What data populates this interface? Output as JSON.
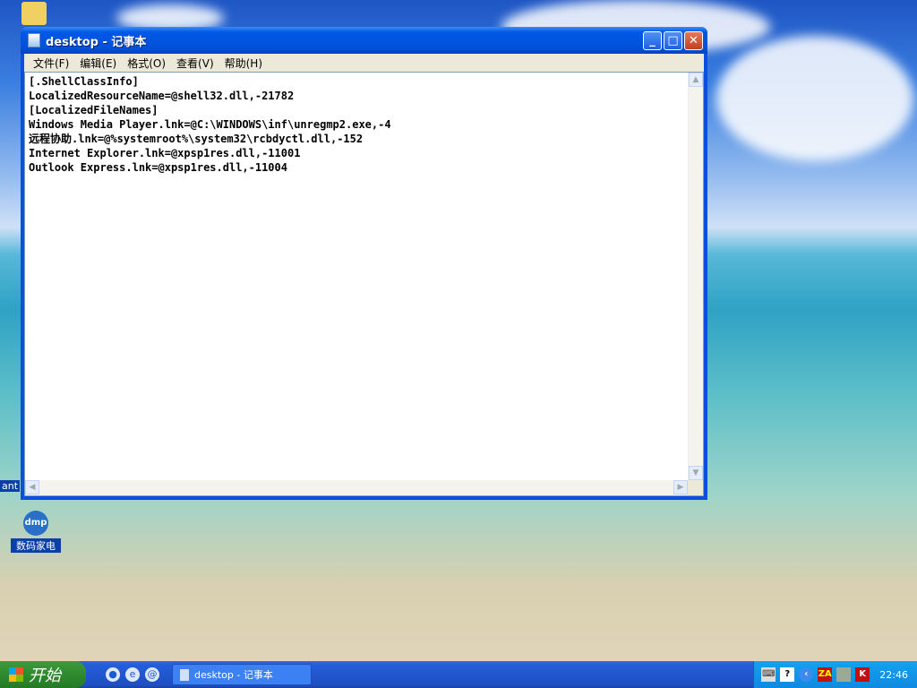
{
  "window": {
    "title": "desktop - 记事本",
    "minimize": "_",
    "maximize": "□",
    "close": "✕"
  },
  "menu": [
    "文件(F)",
    "编辑(E)",
    "格式(O)",
    "查看(V)",
    "帮助(H)"
  ],
  "content": "[.ShellClassInfo]\nLocalizedResourceName=@shell32.dll,-21782\n[LocalizedFileNames]\nWindows Media Player.lnk=@C:\\WINDOWS\\inf\\unregmp2.exe,-4\n远程协助.lnk=@%systemroot%\\system32\\rcbdyctl.dll,-152\nInternet Explorer.lnk=@xpsp1res.dll,-11001\nOutlook Express.lnk=@xpsp1res.dll,-11004",
  "desktop": {
    "icon_label": "数码家电",
    "icon_logo": "dmp",
    "partial_label": "ant"
  },
  "taskbar": {
    "start": "开始",
    "task": "desktop - 记事本",
    "clock": "22:46"
  }
}
